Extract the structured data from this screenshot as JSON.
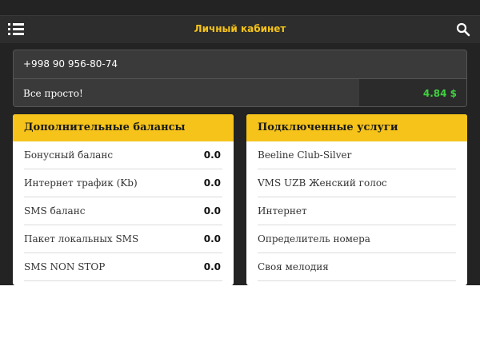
{
  "header": {
    "title": "Личный кабинет"
  },
  "account": {
    "phone": "+998 90 956-80-74",
    "plan": "Все просто!",
    "balance": "4.84 $"
  },
  "balances": {
    "title": "Дополнительные балансы",
    "items": [
      {
        "label": "Бонусный баланс",
        "value": "0.0"
      },
      {
        "label": "Интернет трафик (Kb)",
        "value": "0.0"
      },
      {
        "label": "SMS баланс",
        "value": "0.0"
      },
      {
        "label": "Пакет локальных SMS",
        "value": "0.0"
      },
      {
        "label": "SMS NON STOP",
        "value": "0.0"
      }
    ]
  },
  "services": {
    "title": "Подключенные услуги",
    "items": [
      {
        "label": "Beeline Club-Silver"
      },
      {
        "label": "VMS UZB Женский голос"
      },
      {
        "label": "Интернет"
      },
      {
        "label": "Определитель номера"
      },
      {
        "label": "Своя мелодия"
      }
    ]
  },
  "colors": {
    "accent": "#f5c31a",
    "background": "#232323",
    "balance": "#3fd13f"
  },
  "icons": {
    "menu": "list-menu-icon",
    "search": "search-icon"
  }
}
